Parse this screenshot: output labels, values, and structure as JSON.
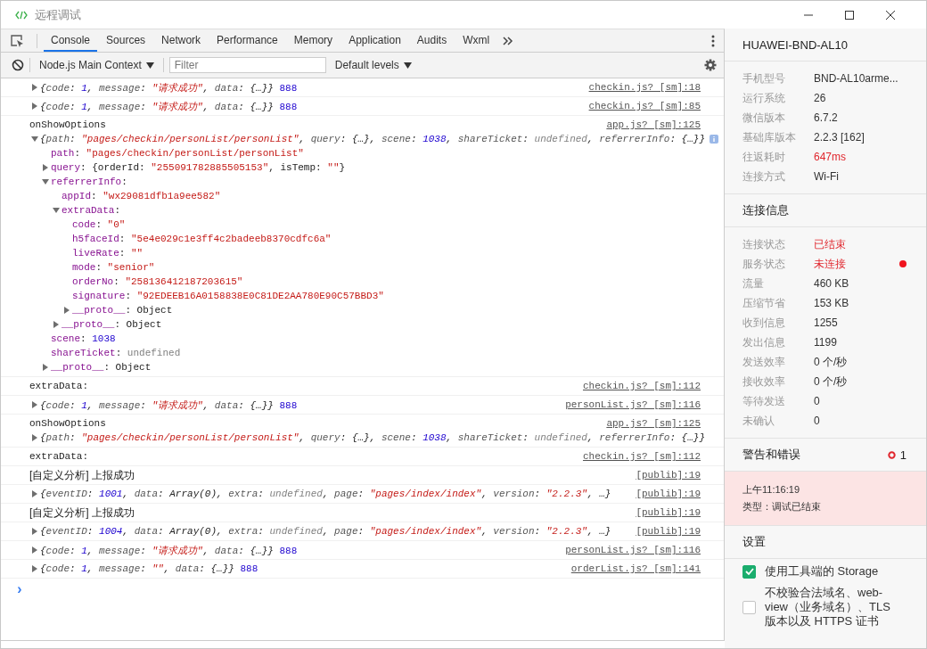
{
  "window": {
    "title": "远程调试"
  },
  "tabs": [
    {
      "label": "Console",
      "selected": true
    },
    {
      "label": "Sources",
      "selected": false
    },
    {
      "label": "Network",
      "selected": false
    },
    {
      "label": "Performance",
      "selected": false
    },
    {
      "label": "Memory",
      "selected": false
    },
    {
      "label": "Application",
      "selected": false
    },
    {
      "label": "Audits",
      "selected": false
    },
    {
      "label": "Wxml",
      "selected": false
    }
  ],
  "toolbar": {
    "context": "Node.js Main Context",
    "filter_placeholder": "Filter",
    "levels": "Default levels"
  },
  "console": {
    "entries": [
      {
        "source": "checkin.js? [sm]:18",
        "items": [
          {
            "expanded": false,
            "preview": true,
            "tokens": [
              {
                "kind": "p",
                "text": "{"
              },
              {
                "kind": "k",
                "text": "code"
              },
              {
                "kind": "p",
                "text": ": "
              },
              {
                "kind": "n",
                "text": "1"
              },
              {
                "kind": "p",
                "text": ", "
              },
              {
                "kind": "k",
                "text": "message"
              },
              {
                "kind": "p",
                "text": ": "
              },
              {
                "kind": "s",
                "text": "\"请求成功\""
              },
              {
                "kind": "p",
                "text": ", "
              },
              {
                "kind": "k",
                "text": "data"
              },
              {
                "kind": "p",
                "text": ": {…}}"
              },
              {
                "kind": "c",
                "text": " 888"
              }
            ]
          }
        ]
      },
      {
        "source": "checkin.js? [sm]:85",
        "items": [
          {
            "expanded": false,
            "preview": true,
            "tokens": [
              {
                "kind": "p",
                "text": "{"
              },
              {
                "kind": "k",
                "text": "code"
              },
              {
                "kind": "p",
                "text": ": "
              },
              {
                "kind": "n",
                "text": "1"
              },
              {
                "kind": "p",
                "text": ", "
              },
              {
                "kind": "k",
                "text": "message"
              },
              {
                "kind": "p",
                "text": ": "
              },
              {
                "kind": "s",
                "text": "\"请求成功\""
              },
              {
                "kind": "p",
                "text": ", "
              },
              {
                "kind": "k",
                "text": "data"
              },
              {
                "kind": "p",
                "text": ": {…}}"
              },
              {
                "kind": "c",
                "text": " 888"
              }
            ]
          }
        ]
      },
      {
        "source": "app.js? [sm]:125",
        "items": [
          {
            "tokens": [
              {
                "kind": "p",
                "text": "onShowOptions"
              }
            ]
          },
          {
            "expanded": true,
            "preview": true,
            "info": true,
            "tokens": [
              {
                "kind": "p",
                "text": "{"
              },
              {
                "kind": "k",
                "text": "path"
              },
              {
                "kind": "p",
                "text": ": "
              },
              {
                "kind": "s",
                "text": "\"pages/checkin/personList/personList\""
              },
              {
                "kind": "p",
                "text": ", "
              },
              {
                "kind": "k",
                "text": "query"
              },
              {
                "kind": "p",
                "text": ": {…}, "
              },
              {
                "kind": "k",
                "text": "scene"
              },
              {
                "kind": "p",
                "text": ": "
              },
              {
                "kind": "n",
                "text": "1038"
              },
              {
                "kind": "p",
                "text": ", "
              },
              {
                "kind": "k",
                "text": "shareTicket"
              },
              {
                "kind": "p",
                "text": ": "
              },
              {
                "kind": "u",
                "text": "undefined"
              },
              {
                "kind": "p",
                "text": ", "
              },
              {
                "kind": "k",
                "text": "referrerInfo"
              },
              {
                "kind": "p",
                "text": ": {…}}"
              }
            ],
            "children": [
              {
                "tokens": [
                  {
                    "kind": "k",
                    "text": "path"
                  },
                  {
                    "kind": "p",
                    "text": ": "
                  },
                  {
                    "kind": "s",
                    "text": "\"pages/checkin/personList/personList\""
                  }
                ]
              },
              {
                "expanded": false,
                "tokens": [
                  {
                    "kind": "k",
                    "text": "query"
                  },
                  {
                    "kind": "p",
                    "text": ": {orderId: "
                  },
                  {
                    "kind": "s",
                    "text": "\"255091782885505153\""
                  },
                  {
                    "kind": "p",
                    "text": ", isTemp: "
                  },
                  {
                    "kind": "s",
                    "text": "\"\""
                  },
                  {
                    "kind": "p",
                    "text": "}"
                  }
                ]
              },
              {
                "expanded": true,
                "tokens": [
                  {
                    "kind": "k",
                    "text": "referrerInfo"
                  },
                  {
                    "kind": "p",
                    "text": ":"
                  }
                ],
                "children": [
                  {
                    "tokens": [
                      {
                        "kind": "k",
                        "text": "appId"
                      },
                      {
                        "kind": "p",
                        "text": ": "
                      },
                      {
                        "kind": "s",
                        "text": "\"wx29081dfb1a9ee582\""
                      }
                    ]
                  },
                  {
                    "expanded": true,
                    "tokens": [
                      {
                        "kind": "k",
                        "text": "extraData"
                      },
                      {
                        "kind": "p",
                        "text": ":"
                      }
                    ],
                    "children": [
                      {
                        "tokens": [
                          {
                            "kind": "k",
                            "text": "code"
                          },
                          {
                            "kind": "p",
                            "text": ": "
                          },
                          {
                            "kind": "s",
                            "text": "\"0\""
                          }
                        ]
                      },
                      {
                        "tokens": [
                          {
                            "kind": "k",
                            "text": "h5faceId"
                          },
                          {
                            "kind": "p",
                            "text": ": "
                          },
                          {
                            "kind": "s",
                            "text": "\"5e4e029c1e3ff4c2badeeb8370cdfc6a\""
                          }
                        ]
                      },
                      {
                        "tokens": [
                          {
                            "kind": "k",
                            "text": "liveRate"
                          },
                          {
                            "kind": "p",
                            "text": ": "
                          },
                          {
                            "kind": "s",
                            "text": "\"\""
                          }
                        ]
                      },
                      {
                        "tokens": [
                          {
                            "kind": "k",
                            "text": "mode"
                          },
                          {
                            "kind": "p",
                            "text": ": "
                          },
                          {
                            "kind": "s",
                            "text": "\"senior\""
                          }
                        ]
                      },
                      {
                        "tokens": [
                          {
                            "kind": "k",
                            "text": "orderNo"
                          },
                          {
                            "kind": "p",
                            "text": ": "
                          },
                          {
                            "kind": "s",
                            "text": "\"258136412187203615\""
                          }
                        ]
                      },
                      {
                        "tokens": [
                          {
                            "kind": "k",
                            "text": "signature"
                          },
                          {
                            "kind": "p",
                            "text": ": "
                          },
                          {
                            "kind": "s",
                            "text": "\"92EDEEB16A0158838E0C81DE2AA780E90C57BBD3\""
                          }
                        ]
                      },
                      {
                        "expanded": false,
                        "tokens": [
                          {
                            "kind": "k",
                            "text": "__proto__"
                          },
                          {
                            "kind": "p",
                            "text": ": Object"
                          }
                        ]
                      }
                    ]
                  },
                  {
                    "expanded": false,
                    "tokens": [
                      {
                        "kind": "k",
                        "text": "__proto__"
                      },
                      {
                        "kind": "p",
                        "text": ": Object"
                      }
                    ]
                  }
                ]
              },
              {
                "tokens": [
                  {
                    "kind": "k",
                    "text": "scene"
                  },
                  {
                    "kind": "p",
                    "text": ": "
                  },
                  {
                    "kind": "n",
                    "text": "1038"
                  }
                ]
              },
              {
                "tokens": [
                  {
                    "kind": "k",
                    "text": "shareTicket"
                  },
                  {
                    "kind": "p",
                    "text": ": "
                  },
                  {
                    "kind": "u",
                    "text": "undefined"
                  }
                ]
              },
              {
                "expanded": false,
                "tokens": [
                  {
                    "kind": "k",
                    "text": "__proto__"
                  },
                  {
                    "kind": "p",
                    "text": ": Object"
                  }
                ]
              }
            ]
          }
        ]
      },
      {
        "source": "checkin.js? [sm]:112",
        "items": [
          {
            "tokens": [
              {
                "kind": "p",
                "text": "extraData:"
              }
            ]
          }
        ]
      },
      {
        "source": "personList.js? [sm]:116",
        "items": [
          {
            "expanded": false,
            "preview": true,
            "tokens": [
              {
                "kind": "p",
                "text": "{"
              },
              {
                "kind": "k",
                "text": "code"
              },
              {
                "kind": "p",
                "text": ": "
              },
              {
                "kind": "n",
                "text": "1"
              },
              {
                "kind": "p",
                "text": ", "
              },
              {
                "kind": "k",
                "text": "message"
              },
              {
                "kind": "p",
                "text": ": "
              },
              {
                "kind": "s",
                "text": "\"请求成功\""
              },
              {
                "kind": "p",
                "text": ", "
              },
              {
                "kind": "k",
                "text": "data"
              },
              {
                "kind": "p",
                "text": ": {…}}"
              },
              {
                "kind": "c",
                "text": " 888"
              }
            ]
          }
        ]
      },
      {
        "source": "app.js? [sm]:125",
        "items": [
          {
            "tokens": [
              {
                "kind": "p",
                "text": "onShowOptions"
              }
            ]
          },
          {
            "expanded": false,
            "preview": true,
            "tokens": [
              {
                "kind": "p",
                "text": "{"
              },
              {
                "kind": "k",
                "text": "path"
              },
              {
                "kind": "p",
                "text": ": "
              },
              {
                "kind": "s",
                "text": "\"pages/checkin/personList/personList\""
              },
              {
                "kind": "p",
                "text": ", "
              },
              {
                "kind": "k",
                "text": "query"
              },
              {
                "kind": "p",
                "text": ": {…}, "
              },
              {
                "kind": "k",
                "text": "scene"
              },
              {
                "kind": "p",
                "text": ": "
              },
              {
                "kind": "n",
                "text": "1038"
              },
              {
                "kind": "p",
                "text": ", "
              },
              {
                "kind": "k",
                "text": "shareTicket"
              },
              {
                "kind": "p",
                "text": ": "
              },
              {
                "kind": "u",
                "text": "undefined"
              },
              {
                "kind": "p",
                "text": ", "
              },
              {
                "kind": "k",
                "text": "referrerInfo"
              },
              {
                "kind": "p",
                "text": ": {…}}"
              }
            ]
          }
        ]
      },
      {
        "source": "checkin.js? [sm]:112",
        "items": [
          {
            "tokens": [
              {
                "kind": "p",
                "text": "extraData:"
              }
            ]
          }
        ]
      },
      {
        "source": "[publib]:19",
        "items": [
          {
            "tokens": [
              {
                "kind": "t",
                "text": "[自定义分析] 上报成功"
              }
            ]
          }
        ]
      },
      {
        "source": "[publib]:19",
        "items": [
          {
            "expanded": false,
            "preview": true,
            "tokens": [
              {
                "kind": "p",
                "text": "{"
              },
              {
                "kind": "k",
                "text": "eventID"
              },
              {
                "kind": "p",
                "text": ": "
              },
              {
                "kind": "n",
                "text": "1001"
              },
              {
                "kind": "p",
                "text": ", "
              },
              {
                "kind": "k",
                "text": "data"
              },
              {
                "kind": "p",
                "text": ": Array(0), "
              },
              {
                "kind": "k",
                "text": "extra"
              },
              {
                "kind": "p",
                "text": ": "
              },
              {
                "kind": "u",
                "text": "undefined"
              },
              {
                "kind": "p",
                "text": ", "
              },
              {
                "kind": "k",
                "text": "page"
              },
              {
                "kind": "p",
                "text": ": "
              },
              {
                "kind": "s",
                "text": "\"pages/index/index\""
              },
              {
                "kind": "p",
                "text": ", "
              },
              {
                "kind": "k",
                "text": "version"
              },
              {
                "kind": "p",
                "text": ": "
              },
              {
                "kind": "s",
                "text": "\"2.2.3\""
              },
              {
                "kind": "p",
                "text": ", …}"
              }
            ]
          }
        ]
      },
      {
        "source": "[publib]:19",
        "items": [
          {
            "tokens": [
              {
                "kind": "t",
                "text": "[自定义分析] 上报成功"
              }
            ]
          }
        ]
      },
      {
        "source": "[publib]:19",
        "items": [
          {
            "expanded": false,
            "preview": true,
            "tokens": [
              {
                "kind": "p",
                "text": "{"
              },
              {
                "kind": "k",
                "text": "eventID"
              },
              {
                "kind": "p",
                "text": ": "
              },
              {
                "kind": "n",
                "text": "1004"
              },
              {
                "kind": "p",
                "text": ", "
              },
              {
                "kind": "k",
                "text": "data"
              },
              {
                "kind": "p",
                "text": ": Array(0), "
              },
              {
                "kind": "k",
                "text": "extra"
              },
              {
                "kind": "p",
                "text": ": "
              },
              {
                "kind": "u",
                "text": "undefined"
              },
              {
                "kind": "p",
                "text": ", "
              },
              {
                "kind": "k",
                "text": "page"
              },
              {
                "kind": "p",
                "text": ": "
              },
              {
                "kind": "s",
                "text": "\"pages/index/index\""
              },
              {
                "kind": "p",
                "text": ", "
              },
              {
                "kind": "k",
                "text": "version"
              },
              {
                "kind": "p",
                "text": ": "
              },
              {
                "kind": "s",
                "text": "\"2.2.3\""
              },
              {
                "kind": "p",
                "text": ", …}"
              }
            ]
          }
        ]
      },
      {
        "source": "personList.js? [sm]:116",
        "items": [
          {
            "expanded": false,
            "preview": true,
            "tokens": [
              {
                "kind": "p",
                "text": "{"
              },
              {
                "kind": "k",
                "text": "code"
              },
              {
                "kind": "p",
                "text": ": "
              },
              {
                "kind": "n",
                "text": "1"
              },
              {
                "kind": "p",
                "text": ", "
              },
              {
                "kind": "k",
                "text": "message"
              },
              {
                "kind": "p",
                "text": ": "
              },
              {
                "kind": "s",
                "text": "\"请求成功\""
              },
              {
                "kind": "p",
                "text": ", "
              },
              {
                "kind": "k",
                "text": "data"
              },
              {
                "kind": "p",
                "text": ": {…}}"
              },
              {
                "kind": "c",
                "text": " 888"
              }
            ]
          }
        ]
      },
      {
        "source": "orderList.js? [sm]:141",
        "items": [
          {
            "expanded": false,
            "preview": true,
            "tokens": [
              {
                "kind": "p",
                "text": "{"
              },
              {
                "kind": "k",
                "text": "code"
              },
              {
                "kind": "p",
                "text": ": "
              },
              {
                "kind": "n",
                "text": "1"
              },
              {
                "kind": "p",
                "text": ", "
              },
              {
                "kind": "k",
                "text": "message"
              },
              {
                "kind": "p",
                "text": ": "
              },
              {
                "kind": "s",
                "text": "\"\""
              },
              {
                "kind": "p",
                "text": ", "
              },
              {
                "kind": "k",
                "text": "data"
              },
              {
                "kind": "p",
                "text": ": {…}}"
              },
              {
                "kind": "c",
                "text": " 888"
              }
            ]
          }
        ]
      }
    ],
    "prompt": "›"
  },
  "sidebar": {
    "device": "HUAWEI-BND-AL10",
    "device_info": [
      {
        "label": "手机型号",
        "value": "BND-AL10arme...",
        "alert": false
      },
      {
        "label": "运行系统",
        "value": "26",
        "alert": false
      },
      {
        "label": "微信版本",
        "value": "6.7.2",
        "alert": false
      },
      {
        "label": "基础库版本",
        "value": "2.2.3 [162]",
        "alert": false
      },
      {
        "label": "往返耗时",
        "value": "647ms",
        "alert": true
      },
      {
        "label": "连接方式",
        "value": "Wi-Fi",
        "alert": false
      }
    ],
    "connection_title": "连接信息",
    "connection": [
      {
        "label": "连接状态",
        "value": "已结束",
        "alert": true,
        "dot": false
      },
      {
        "label": "服务状态",
        "value": "未连接",
        "alert": true,
        "dot": true
      },
      {
        "label": "流量",
        "value": "460 KB",
        "alert": false,
        "dot": false
      },
      {
        "label": "压缩节省",
        "value": "153 KB",
        "alert": false,
        "dot": false
      },
      {
        "label": "收到信息",
        "value": "1255",
        "alert": false,
        "dot": false
      },
      {
        "label": "发出信息",
        "value": "1199",
        "alert": false,
        "dot": false
      },
      {
        "label": "发送效率",
        "value": "0 个/秒",
        "alert": false,
        "dot": false
      },
      {
        "label": "接收效率",
        "value": "0 个/秒",
        "alert": false,
        "dot": false
      },
      {
        "label": "等待发送",
        "value": "0",
        "alert": false,
        "dot": false
      },
      {
        "label": "未确认",
        "value": "0",
        "alert": false,
        "dot": false
      }
    ],
    "warnings": {
      "title": "警告和错误",
      "count": "1"
    },
    "alert": {
      "time": "上午11:16:19",
      "type": "类型：调试已结束"
    },
    "settings_title": "设置",
    "settings": [
      {
        "label": "使用工具端的 Storage",
        "checked": true
      },
      {
        "label": "不校验合法域名、web-view（业务域名）、TLS 版本以及 HTTPS 证书",
        "checked": false
      }
    ]
  }
}
